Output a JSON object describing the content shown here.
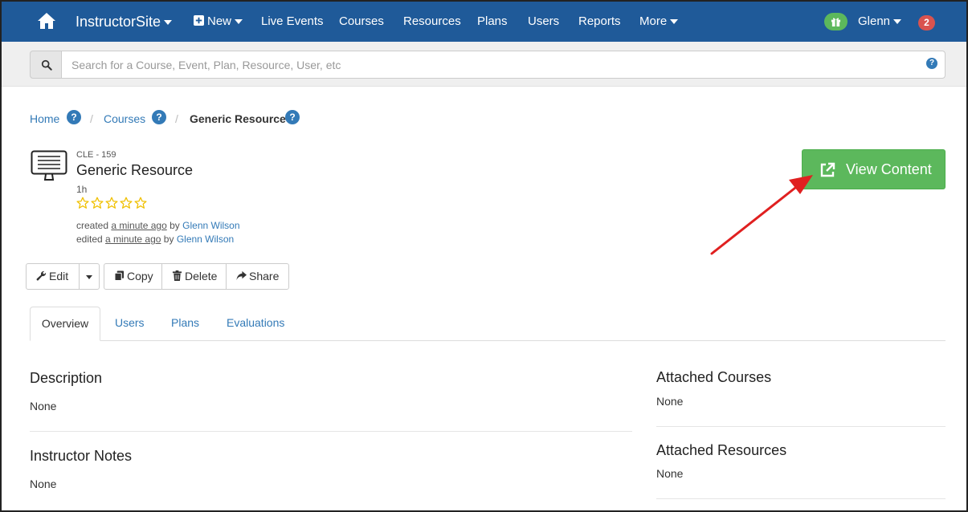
{
  "navbar": {
    "brand": "InstructorSite",
    "new_label": "New",
    "items": [
      "Live Events",
      "Courses",
      "Resources",
      "Plans",
      "Users",
      "Reports"
    ],
    "more_label": "More",
    "user_name": "Glenn",
    "notification_count": "2",
    "bg_color": "#1f5a99"
  },
  "search": {
    "placeholder": "Search for a Course, Event, Plan, Resource, User, etc",
    "help_label": "?"
  },
  "breadcrumb": {
    "home": "Home",
    "courses": "Courses",
    "current": "Generic Resource",
    "separator": "/",
    "help_label": "?"
  },
  "resource": {
    "code": "CLE - 159",
    "title": "Generic Resource",
    "duration": "1h",
    "rating": 0,
    "rating_max": 5,
    "created_prefix": "created",
    "created_when": "a minute ago",
    "by_word": "by",
    "created_by": "Glenn Wilson",
    "edited_prefix": "edited",
    "edited_when": "a minute ago",
    "edited_by": "Glenn Wilson"
  },
  "view_content": {
    "label": "View Content",
    "color": "#5cb85c"
  },
  "toolbar": {
    "edit": "Edit",
    "copy": "Copy",
    "delete": "Delete",
    "share": "Share"
  },
  "tabs": [
    "Overview",
    "Users",
    "Plans",
    "Evaluations"
  ],
  "sections": {
    "description_title": "Description",
    "description_value": "None",
    "notes_title": "Instructor Notes",
    "notes_value": "None",
    "attached_courses_title": "Attached Courses",
    "attached_courses_value": "None",
    "attached_resources_title": "Attached Resources",
    "attached_resources_value": "None"
  },
  "annotation_color": "#e02020"
}
